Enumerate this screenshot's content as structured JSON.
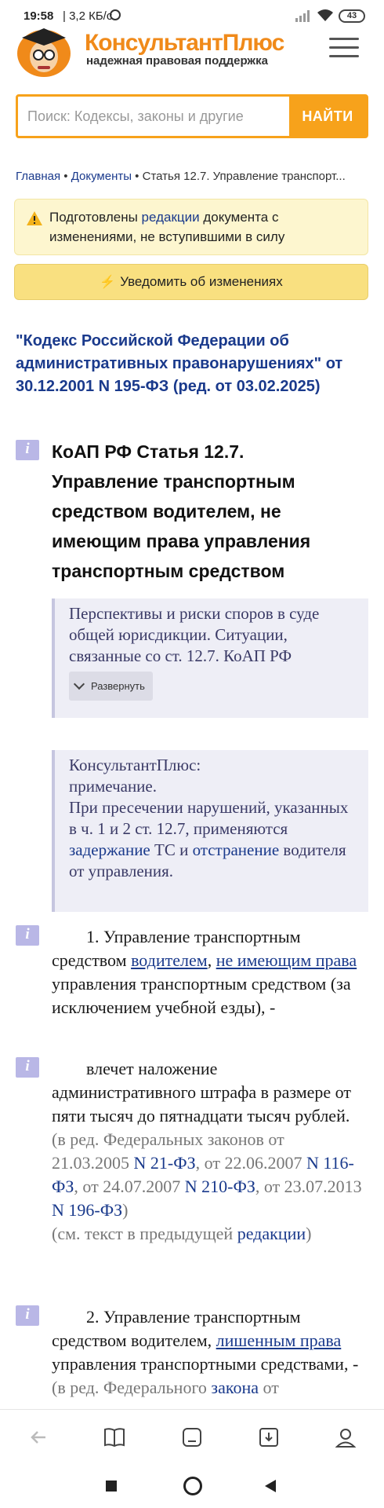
{
  "status_bar": {
    "time": "19:58",
    "network": "| 3,2 КБ/с",
    "battery": "43"
  },
  "header": {
    "logo_name": "КонсультантПлюс",
    "logo_tagline": "надежная правовая поддержка"
  },
  "search": {
    "placeholder": "Поиск: Кодексы, законы и другие",
    "button_label": "НАЙТИ"
  },
  "breadcrumb": {
    "home": "Главная",
    "sep1": " • ",
    "documents": "Документы",
    "sep2": " • ",
    "current": "Статья 12.7. Управление транспорт..."
  },
  "notice": {
    "text_before": "Подготовлены ",
    "link": "редакции",
    "text_after": " документа с изменениями, не вступившими в силу",
    "notify_button": "Уведомить об изменениях"
  },
  "document": {
    "title": "\"Кодекс Российской Федерации об административных правонарушениях\" от 30.12.2001 N 195-ФЗ (ред. от 03.02.2025)",
    "article_heading": "КоАП РФ Статья 12.7. Управление транспортным средством водителем, не имеющим права управления транспортным средством",
    "box1": {
      "text": "Перспективы и риски споров в суде общей юрисдикции. Ситуации, связанные со ст. 12.7. КоАП РФ",
      "expand_label": "Развернуть"
    },
    "box2": {
      "line1": "КонсультантПлюс:",
      "line2": "примечание.",
      "text_before": "При пресечении нарушений, указанных в ч. 1 и 2 ст. 12.7, применяются ",
      "link1": "задержание",
      "text_mid": " ТС и ",
      "link2": "отстранение",
      "text_after": " водителя от управления."
    },
    "para1": {
      "t1": "1. Управление транспортным средством ",
      "l1": "водителем",
      "t2": ", ",
      "l2": "не имеющим права",
      "t3": " управления транспортным средством (за исключением учебной езды), -"
    },
    "para2": {
      "t1": "влечет наложение административного штрафа в размере от пяти тысяч до пятнадцати тысяч рублей.",
      "g1": "(в ред. Федеральных законов от 21.03.2005 ",
      "l1": "N 21-ФЗ",
      "g2": ", от 22.06.2007 ",
      "l2": "N 116-ФЗ",
      "g3": ", от 24.07.2007 ",
      "l3": "N 210-ФЗ",
      "g4": ", от 23.07.2013 ",
      "l4": "N 196-ФЗ",
      "g5": ")",
      "g6": "(см. текст в предыдущей ",
      "l5": "редакции",
      "g7": ")"
    },
    "para3": {
      "t1": "2. Управление транспортным средством водителем, ",
      "l1": "лишенным права",
      "t2": " управления транспортными средствами, -",
      "g1": "(в ред. Федерального ",
      "l2": "закона",
      "g2": " от"
    }
  }
}
